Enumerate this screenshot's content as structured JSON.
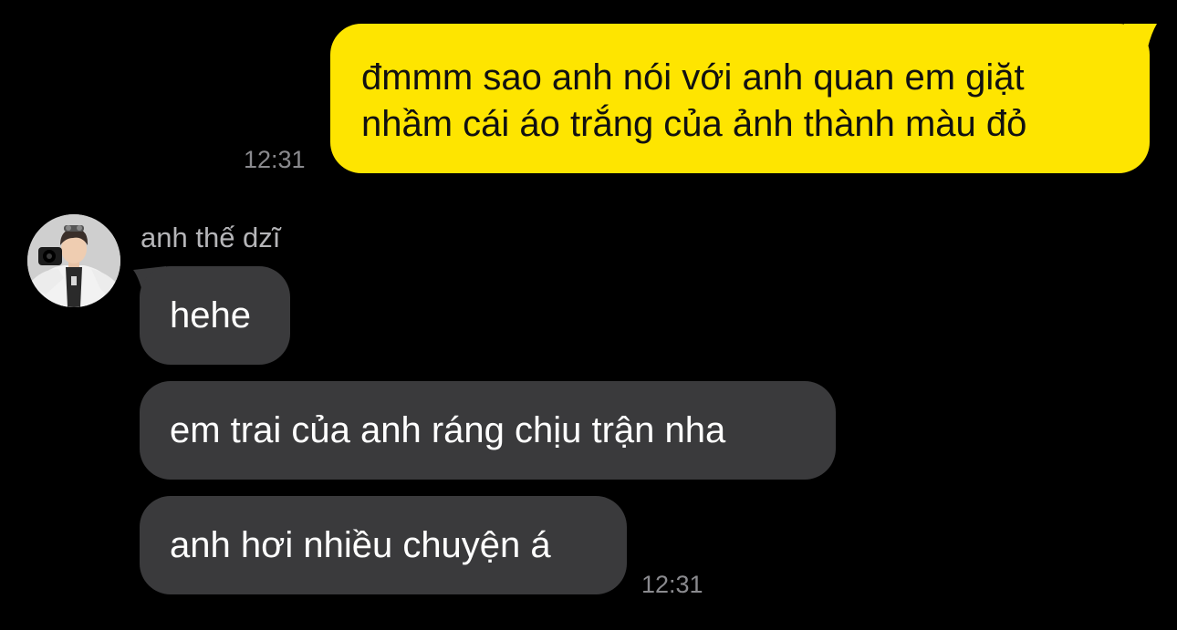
{
  "colors": {
    "background": "#000000",
    "sent_bubble": "#FEE500",
    "received_bubble": "#3A3A3C",
    "timestamp": "#8A8A8E",
    "sender_name": "#B5B5B8"
  },
  "messages": {
    "sent": {
      "lines": [
        "đmmm sao anh nói với anh quan em giặt",
        "nhầm cái áo trắng của ảnh thành màu đỏ"
      ],
      "time": "12:31"
    },
    "received": {
      "sender_name": "anh thế dzĩ",
      "avatar_icon": "profile-photo",
      "bubbles": [
        {
          "text": "hehe"
        },
        {
          "text": "em trai của anh ráng chịu trận nha"
        },
        {
          "text": "anh hơi nhiều chuyện á"
        }
      ],
      "time": "12:31"
    }
  }
}
